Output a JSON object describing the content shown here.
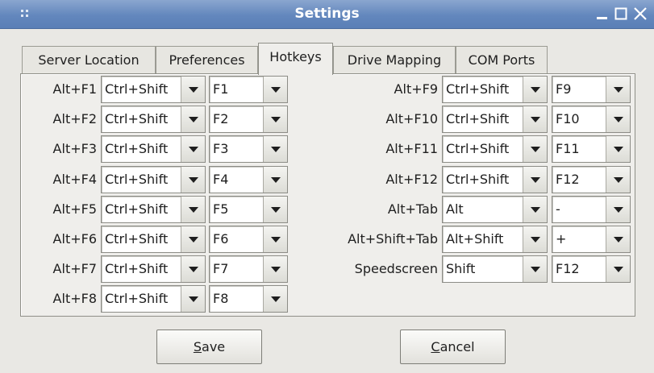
{
  "window": {
    "title": "Settings"
  },
  "tabs": [
    "Server Location",
    "Preferences",
    "Hotkeys",
    "Drive Mapping",
    "COM Ports"
  ],
  "active_tab": "Hotkeys",
  "hotkeys_left": [
    {
      "label": "Alt+F1",
      "modifier": "Ctrl+Shift",
      "key": "F1"
    },
    {
      "label": "Alt+F2",
      "modifier": "Ctrl+Shift",
      "key": "F2"
    },
    {
      "label": "Alt+F3",
      "modifier": "Ctrl+Shift",
      "key": "F3"
    },
    {
      "label": "Alt+F4",
      "modifier": "Ctrl+Shift",
      "key": "F4"
    },
    {
      "label": "Alt+F5",
      "modifier": "Ctrl+Shift",
      "key": "F5"
    },
    {
      "label": "Alt+F6",
      "modifier": "Ctrl+Shift",
      "key": "F6"
    },
    {
      "label": "Alt+F7",
      "modifier": "Ctrl+Shift",
      "key": "F7"
    },
    {
      "label": "Alt+F8",
      "modifier": "Ctrl+Shift",
      "key": "F8"
    }
  ],
  "hotkeys_right": [
    {
      "label": "Alt+F9",
      "modifier": "Ctrl+Shift",
      "key": "F9"
    },
    {
      "label": "Alt+F10",
      "modifier": "Ctrl+Shift",
      "key": "F10"
    },
    {
      "label": "Alt+F11",
      "modifier": "Ctrl+Shift",
      "key": "F11"
    },
    {
      "label": "Alt+F12",
      "modifier": "Ctrl+Shift",
      "key": "F12"
    },
    {
      "label": "Alt+Tab",
      "modifier": "Alt",
      "key": "-"
    },
    {
      "label": "Alt+Shift+Tab",
      "modifier": "Alt+Shift",
      "key": "+"
    },
    {
      "label": "Speedscreen",
      "modifier": "Shift",
      "key": "F12"
    }
  ],
  "buttons": {
    "save": {
      "mnemonic": "S",
      "rest": "ave"
    },
    "cancel": {
      "mnemonic": "C",
      "rest": "ancel"
    }
  },
  "icons": {
    "window_menu": "grip-icon",
    "minimize": "minimize-icon",
    "maximize": "maximize-icon",
    "close": "close-icon",
    "dropdown": "chevron-down-icon"
  },
  "colors": {
    "titlebar": "#6387bd",
    "title_text": "#ffffff",
    "dialog_background": "#e9e8e4",
    "field_background": "#ffffff"
  }
}
